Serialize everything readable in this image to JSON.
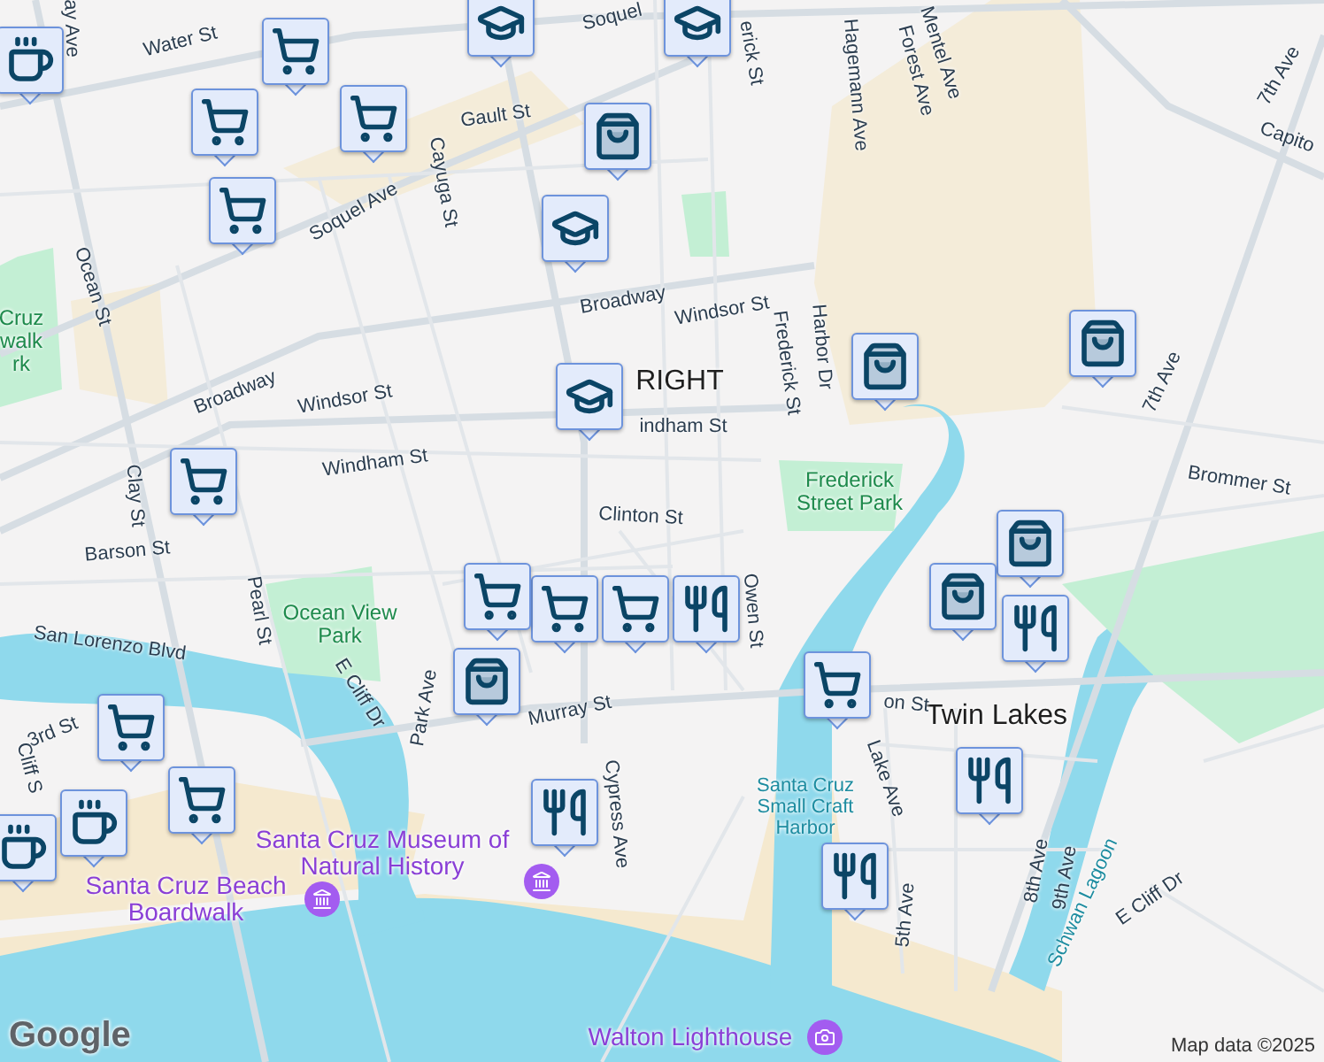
{
  "labels": [
    {
      "text": "ay Ave",
      "kind": "street"
    },
    {
      "text": "Water St",
      "kind": "street"
    },
    {
      "text": "Soquel",
      "kind": "street"
    },
    {
      "text": "Gault St",
      "kind": "street"
    },
    {
      "text": "Cayuga St",
      "kind": "street"
    },
    {
      "text": "Soquel Ave",
      "kind": "street"
    },
    {
      "text": "Ocean St",
      "kind": "street"
    },
    {
      "text": "Broadway",
      "kind": "street"
    },
    {
      "text": "Broadway",
      "kind": "street"
    },
    {
      "text": "Windsor St",
      "kind": "street"
    },
    {
      "text": "Windsor St",
      "kind": "street"
    },
    {
      "text": "Windham St",
      "kind": "street"
    },
    {
      "text": "RIGHT",
      "kind": "place"
    },
    {
      "text": "indham St",
      "kind": "street"
    },
    {
      "text": "Clinton St",
      "kind": "street"
    },
    {
      "text": "Clay St",
      "kind": "street"
    },
    {
      "text": "Barson St",
      "kind": "street"
    },
    {
      "text": "Pearl St",
      "kind": "street"
    },
    {
      "text": "Ocean View Park",
      "kind": "park"
    },
    {
      "text": "San Lorenzo Blvd",
      "kind": "street"
    },
    {
      "text": "E Cliff Dr",
      "kind": "street"
    },
    {
      "text": "Park Ave",
      "kind": "street"
    },
    {
      "text": "Murray St",
      "kind": "street"
    },
    {
      "text": "Cypress Ave",
      "kind": "street"
    },
    {
      "text": "3rd St",
      "kind": "street"
    },
    {
      "text": "Cliff S",
      "kind": "street"
    },
    {
      "text": "Cruz walk rk",
      "kind": "park"
    },
    {
      "text": "Santa Cruz Beach Boardwalk",
      "kind": "poi"
    },
    {
      "text": "Santa Cruz Museum of Natural History",
      "kind": "poi"
    },
    {
      "text": "Walton Lighthouse",
      "kind": "poi"
    },
    {
      "text": "Twin Lakes",
      "kind": "place"
    },
    {
      "text": "Frederick Street Park",
      "kind": "park"
    },
    {
      "text": "5th Ave",
      "kind": "street"
    },
    {
      "text": "8th Ave",
      "kind": "street"
    },
    {
      "text": "9th Ave",
      "kind": "street"
    },
    {
      "text": "Schwan Lagoon",
      "kind": "water"
    },
    {
      "text": "E Cliff Dr",
      "kind": "street"
    },
    {
      "text": "Lake Ave",
      "kind": "street"
    },
    {
      "text": "on St",
      "kind": "street"
    },
    {
      "text": "Owen St",
      "kind": "street"
    },
    {
      "text": "Santa Cruz Small Craft Harbor",
      "kind": "water"
    },
    {
      "text": "Brommer St",
      "kind": "street"
    },
    {
      "text": "7th Ave",
      "kind": "street"
    },
    {
      "text": "7th Ave",
      "kind": "street"
    },
    {
      "text": "Capito",
      "kind": "street"
    },
    {
      "text": "erick St",
      "kind": "street"
    },
    {
      "text": "Frederick St",
      "kind": "street"
    },
    {
      "text": "Hagemann Ave",
      "kind": "street"
    },
    {
      "text": "Mentel Ave",
      "kind": "street"
    },
    {
      "text": "Forest Ave",
      "kind": "street"
    },
    {
      "text": "Harbor Dr",
      "kind": "street"
    }
  ],
  "markers": [
    {
      "kind": "cup"
    },
    {
      "kind": "cart"
    },
    {
      "kind": "cart"
    },
    {
      "kind": "cart"
    },
    {
      "kind": "cart"
    },
    {
      "kind": "cap"
    },
    {
      "kind": "cap"
    },
    {
      "kind": "bag"
    },
    {
      "kind": "cap"
    },
    {
      "kind": "cap"
    },
    {
      "kind": "cart"
    },
    {
      "kind": "bag"
    },
    {
      "kind": "bag"
    },
    {
      "kind": "bag"
    },
    {
      "kind": "bag"
    },
    {
      "kind": "cart"
    },
    {
      "kind": "cart"
    },
    {
      "kind": "fork"
    },
    {
      "kind": "cart"
    },
    {
      "kind": "bag"
    },
    {
      "kind": "cart"
    },
    {
      "kind": "fork"
    },
    {
      "kind": "fork"
    },
    {
      "kind": "fork"
    },
    {
      "kind": "cart"
    },
    {
      "kind": "cart"
    },
    {
      "kind": "cup"
    },
    {
      "kind": "cup"
    },
    {
      "kind": "fork"
    }
  ],
  "logo": "Google",
  "attribution": "Map data ©2025"
}
